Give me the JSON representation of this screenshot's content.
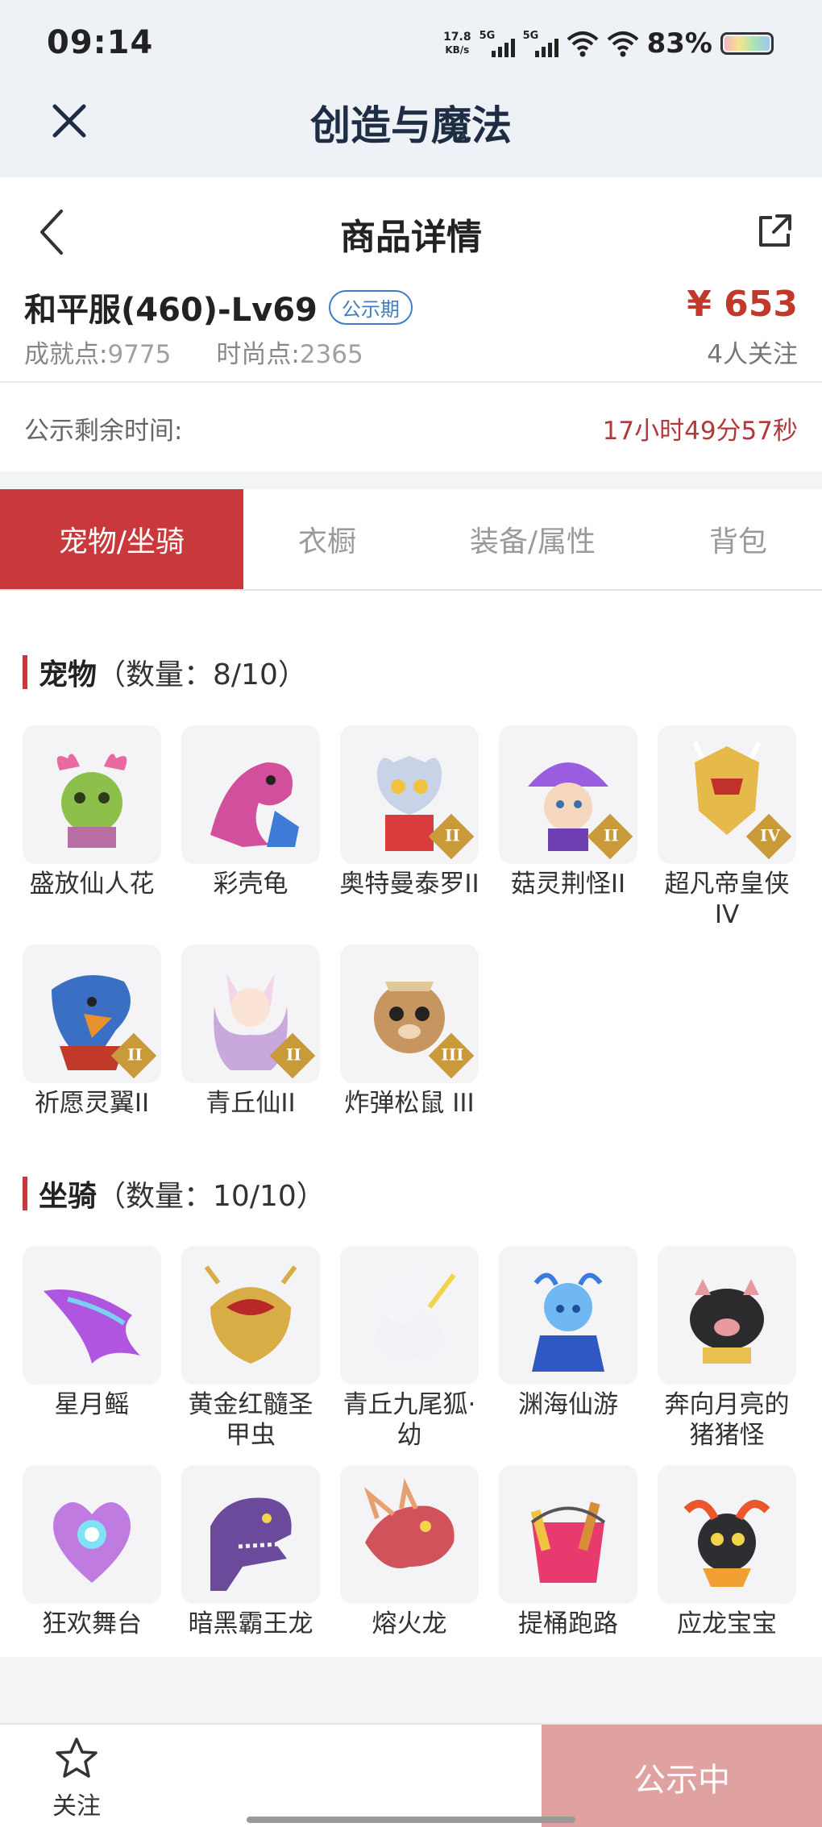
{
  "status_bar": {
    "time": "09:14",
    "net_speed": "17.8",
    "net_unit": "KB/s",
    "sim1": "5G",
    "sim2": "5G",
    "battery": "83%",
    "battery_level": 0.83
  },
  "app": {
    "title": "创造与魔法"
  },
  "nav": {
    "title": "商品详情"
  },
  "item": {
    "name": "和平服(460)-Lv69",
    "badge": "公示期",
    "achievement_label": "成就点:",
    "achievement_value": "9775",
    "fashion_label": "时尚点:",
    "fashion_value": "2365",
    "price": "¥ 653",
    "followers": "4人关注"
  },
  "countdown": {
    "label": "公示剩余时间:",
    "value": "17小时49分57秒"
  },
  "tabs": [
    "宠物/坐骑",
    "衣橱",
    "装备/属性",
    "背包"
  ],
  "pets": {
    "title_bold": "宠物",
    "title_rest": "（数量：8/10）",
    "items": [
      {
        "name": "盛放仙人花",
        "icon": "cactus-flower-icon",
        "rank": ""
      },
      {
        "name": "彩壳龟",
        "icon": "pink-creature-icon",
        "rank": ""
      },
      {
        "name": "奥特曼泰罗II",
        "icon": "ultraman-icon",
        "rank": "II"
      },
      {
        "name": "菇灵荆怪II",
        "icon": "mushroom-spirit-icon",
        "rank": "II"
      },
      {
        "name": "超凡帝皇侠IV",
        "icon": "golden-armor-icon",
        "rank": "IV"
      },
      {
        "name": "祈愿灵翼II",
        "icon": "eagle-icon",
        "rank": "II"
      },
      {
        "name": "青丘仙II",
        "icon": "fox-fairy-icon",
        "rank": "II"
      },
      {
        "name": "炸弹松鼠 III",
        "icon": "squirrel-icon",
        "rank": "III"
      }
    ]
  },
  "mounts": {
    "title_bold": "坐骑",
    "title_rest": "（数量：10/10）",
    "items": [
      {
        "name": "星月鳐",
        "icon": "manta-ray-icon"
      },
      {
        "name": "黄金红髓圣甲虫",
        "icon": "golden-beetle-icon"
      },
      {
        "name": "青丘九尾狐·幼",
        "icon": "nine-tail-fox-icon"
      },
      {
        "name": "渊海仙游",
        "icon": "sea-fairy-icon"
      },
      {
        "name": "奔向月亮的猪猪怪",
        "icon": "pig-icon"
      },
      {
        "name": "狂欢舞台",
        "icon": "heart-stage-icon"
      },
      {
        "name": "暗黑霸王龙",
        "icon": "t-rex-icon"
      },
      {
        "name": "熔火龙",
        "icon": "fire-dragon-icon"
      },
      {
        "name": "提桶跑路",
        "icon": "bucket-icon"
      },
      {
        "name": "应龙宝宝",
        "icon": "baby-dragon-icon"
      }
    ]
  },
  "bottom": {
    "follow_label": "关注",
    "status_label": "公示中"
  },
  "colors": {
    "accent": "#c9393c",
    "price": "#c0392b",
    "badge": "#3f7ec4",
    "status_button": "#e0a1a1"
  }
}
